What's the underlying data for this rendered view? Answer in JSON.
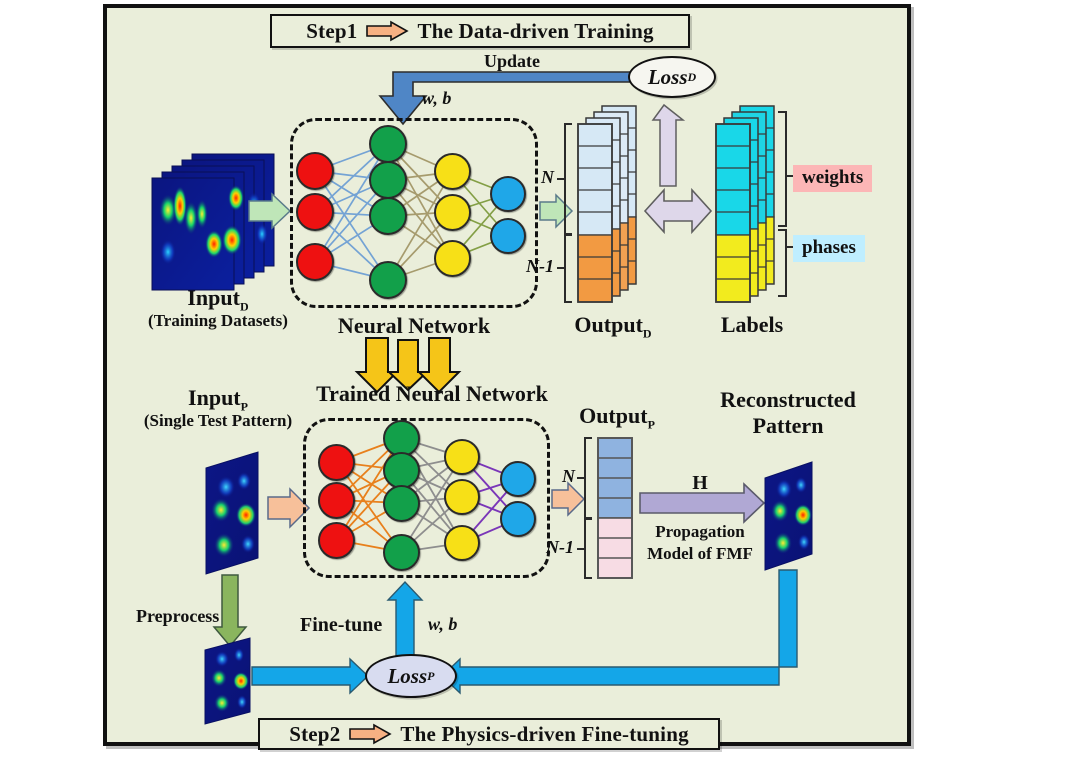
{
  "figure": {
    "title_absent": true,
    "background_color": "#eaeeda",
    "frame_color": "#111111"
  },
  "steps": [
    {
      "id": "step1",
      "number": "Step1",
      "arrow": "right-arrow-icon",
      "text": "The Data-driven Training"
    },
    {
      "id": "step2",
      "number": "Step2",
      "arrow": "right-arrow-icon",
      "text": "The Physics-driven Fine-tuning"
    }
  ],
  "top": {
    "update_label": "Update",
    "wb_label": "w, b",
    "loss_label": "Loss",
    "loss_sub": "D",
    "input_label": "Input",
    "input_sub": "D",
    "input_caption": "(Training Datasets)",
    "network_label": "Neural Network",
    "output_label": "Output",
    "output_sub": "D",
    "labels_label": "Labels",
    "bracket_n": "N",
    "bracket_n1": "N-1",
    "tag_weights": "weights",
    "tag_phases": "phases",
    "colors": {
      "input_arrow": "#bfe6b8",
      "output_top_cell": "#d6e8f5",
      "output_bottom_cell": "#f29a42",
      "label_top_cell": "#19d7e8",
      "label_bottom_cell": "#f2eb1e",
      "update_arrow": "#4f86c6",
      "compare_arrow": "#ded7ea",
      "weights_tag": "#fcb6b6",
      "phases_tag": "#bfeeff"
    }
  },
  "transition": {
    "arrow_count": 3,
    "arrow_color": "#f5c518",
    "trained_label": "Trained Neural Network"
  },
  "bottom": {
    "input_label": "Input",
    "input_sub": "P",
    "input_caption": "(Single Test Pattern)",
    "preprocess_label": "Preprocess",
    "finetune_label": "Fine-tune",
    "wb_label": "w, b",
    "loss_label": "Loss",
    "loss_sub": "P",
    "output_label": "Output",
    "output_sub": "P",
    "bracket_n": "N",
    "bracket_n1": "N-1",
    "h_label": "H",
    "propagation_line1": "Propagation",
    "propagation_line2": "Model of FMF",
    "reconstructed_line1": "Reconstructed",
    "reconstructed_line2": "Pattern",
    "colors": {
      "input_arrow": "#f7c09a",
      "preprocess_arrow": "#8ab55e",
      "output_top_cell": "#8fb3e0",
      "output_bottom_cell": "#f7dce4",
      "h_arrow": "#b0a8d4",
      "feedback_arrow": "#14a6e8",
      "loss_fill": "#d8dcf0"
    }
  },
  "network_top": {
    "layers": [
      {
        "name": "input-layer",
        "color": "#ee1111",
        "count": 3
      },
      {
        "name": "hidden-layer-1",
        "color": "#12a04a",
        "count": 4
      },
      {
        "name": "hidden-layer-2",
        "color": "#f7e017",
        "count": 3
      },
      {
        "name": "output-layer",
        "color": "#1fa7e8",
        "count": 2
      }
    ],
    "edge_colors": [
      "#6e9fd4",
      "#a39768",
      "#7e9b3e"
    ]
  },
  "network_bottom": {
    "layers": [
      {
        "name": "input-layer",
        "color": "#ee1111",
        "count": 3
      },
      {
        "name": "hidden-layer-1",
        "color": "#12a04a",
        "count": 4
      },
      {
        "name": "hidden-layer-2",
        "color": "#f7e017",
        "count": 3
      },
      {
        "name": "output-layer",
        "color": "#1fa7e8",
        "count": 2
      }
    ],
    "edge_colors": [
      "#e8801c",
      "#8e8e8e",
      "#7a36b8"
    ]
  },
  "chart_data": {
    "type": "diagram",
    "top_output_vector": {
      "N_cells": 5,
      "N_minus_1_cells": 3,
      "stack_depth": 4
    },
    "top_labels_vector": {
      "N_cells": 5,
      "N_minus_1_cells": 3,
      "stack_depth": 4
    },
    "bottom_output_vector": {
      "N_cells": 4,
      "N_minus_1_cells": 3,
      "stack_depth": 1
    },
    "input_stack_count": 5
  }
}
